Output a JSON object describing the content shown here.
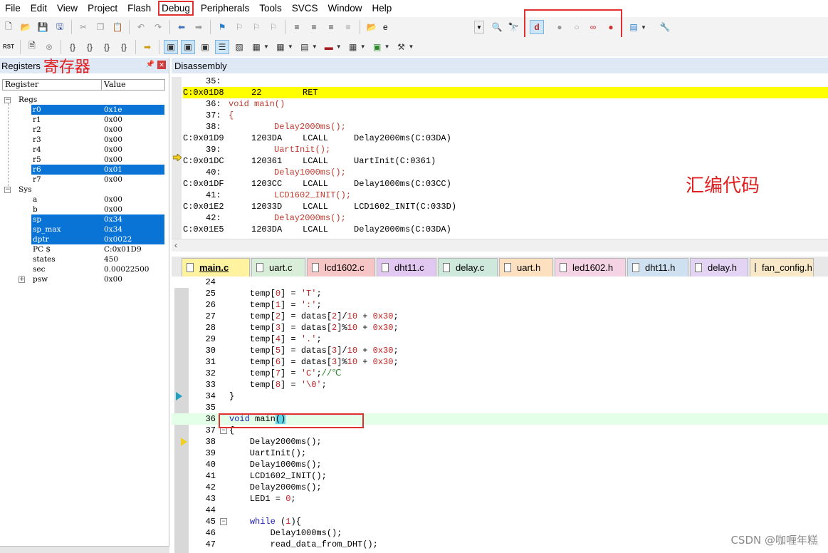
{
  "menu": [
    "File",
    "Edit",
    "View",
    "Project",
    "Flash",
    "Debug",
    "Peripherals",
    "Tools",
    "SVCS",
    "Window",
    "Help"
  ],
  "toolbar": {
    "combo_value": "e",
    "rst_label": "RST"
  },
  "registers": {
    "title": "Registers",
    "annotation": "寄存器",
    "col_register": "Register",
    "col_value": "Value",
    "regs_group": "Regs",
    "regs": [
      {
        "name": "r0",
        "value": "0x1e",
        "selected": true
      },
      {
        "name": "r1",
        "value": "0x00",
        "selected": false
      },
      {
        "name": "r2",
        "value": "0x00",
        "selected": false
      },
      {
        "name": "r3",
        "value": "0x00",
        "selected": false
      },
      {
        "name": "r4",
        "value": "0x00",
        "selected": false
      },
      {
        "name": "r5",
        "value": "0x00",
        "selected": false
      },
      {
        "name": "r6",
        "value": "0x01",
        "selected": true
      },
      {
        "name": "r7",
        "value": "0x00",
        "selected": false
      }
    ],
    "sys_group": "Sys",
    "sys": [
      {
        "name": "a",
        "value": "0x00",
        "selected": false
      },
      {
        "name": "b",
        "value": "0x00",
        "selected": false
      },
      {
        "name": "sp",
        "value": "0x34",
        "selected": true
      },
      {
        "name": "sp_max",
        "value": "0x34",
        "selected": true
      },
      {
        "name": "dptr",
        "value": "0x0022",
        "selected": true
      },
      {
        "name": "PC  $",
        "value": "C:0x01D9",
        "selected": false
      },
      {
        "name": "states",
        "value": "450",
        "selected": false
      },
      {
        "name": "sec",
        "value": "0.00022500",
        "selected": false
      }
    ],
    "psw": {
      "name": "psw",
      "value": "0x00"
    }
  },
  "disassembly": {
    "title": "Disassembly",
    "annotation": "汇编代码",
    "lines": [
      {
        "kind": "src",
        "num": "35:",
        "text": ""
      },
      {
        "kind": "asm",
        "addr": "C:0x01D8",
        "op": "22",
        "mn": "RET",
        "args": "",
        "current": true
      },
      {
        "kind": "src",
        "num": "36:",
        "text": "void main()"
      },
      {
        "kind": "src",
        "num": "37:",
        "text": "{"
      },
      {
        "kind": "src",
        "num": "38:",
        "text": "Delay2000ms();",
        "indent": true
      },
      {
        "kind": "asm",
        "addr": "C:0x01D9",
        "op": "1203DA",
        "mn": "LCALL",
        "args": "Delay2000ms(C:03DA)"
      },
      {
        "kind": "src",
        "num": "39:",
        "text": "UartInit();",
        "indent": true
      },
      {
        "kind": "asm",
        "addr": "C:0x01DC",
        "op": "120361",
        "mn": "LCALL",
        "args": "UartInit(C:0361)"
      },
      {
        "kind": "src",
        "num": "40:",
        "text": "Delay1000ms();",
        "indent": true
      },
      {
        "kind": "asm",
        "addr": "C:0x01DF",
        "op": "1203CC",
        "mn": "LCALL",
        "args": "Delay1000ms(C:03CC)"
      },
      {
        "kind": "src",
        "num": "41:",
        "text": "LCD1602_INIT();",
        "indent": true
      },
      {
        "kind": "asm",
        "addr": "C:0x01E2",
        "op": "12033D",
        "mn": "LCALL",
        "args": "LCD1602_INIT(C:033D)"
      },
      {
        "kind": "src",
        "num": "42:",
        "text": "Delay2000ms();",
        "indent": true
      },
      {
        "kind": "asm",
        "addr": "C:0x01E5",
        "op": "1203DA",
        "mn": "LCALL",
        "args": "Delay2000ms(C:03DA)"
      }
    ]
  },
  "tabs": [
    {
      "label": "main.c",
      "color": "#fff3a0",
      "active": true
    },
    {
      "label": "uart.c",
      "color": "#d8eed8"
    },
    {
      "label": "lcd1602.c",
      "color": "#f6c6c6"
    },
    {
      "label": "dht11.c",
      "color": "#e0c8f0"
    },
    {
      "label": "delay.c",
      "color": "#cfe8dc"
    },
    {
      "label": "uart.h",
      "color": "#fde0c0"
    },
    {
      "label": "led1602.h",
      "color": "#f4d4e4"
    },
    {
      "label": "dht11.h",
      "color": "#cfe0f0"
    },
    {
      "label": "delay.h",
      "color": "#e4d4f4"
    },
    {
      "label": "fan_config.h",
      "color": "#f8e8c8"
    }
  ],
  "code": {
    "lines": [
      {
        "n": "24",
        "text": ""
      },
      {
        "n": "25",
        "text": "    temp[0] = 'T';"
      },
      {
        "n": "26",
        "text": "    temp[1] = ':';"
      },
      {
        "n": "27",
        "text": "    temp[2] = datas[2]/10 + 0x30;"
      },
      {
        "n": "28",
        "text": "    temp[3] = datas[2]%10 + 0x30;"
      },
      {
        "n": "29",
        "text": "    temp[4] = '.';"
      },
      {
        "n": "30",
        "text": "    temp[5] = datas[3]/10 + 0x30;"
      },
      {
        "n": "31",
        "text": "    temp[6] = datas[3]%10 + 0x30;"
      },
      {
        "n": "32",
        "text": "    temp[7] = 'C';//℃"
      },
      {
        "n": "33",
        "text": "    temp[8] = '\\0';"
      },
      {
        "n": "34",
        "text": "}"
      },
      {
        "n": "35",
        "text": ""
      },
      {
        "n": "36",
        "text": "void main()"
      },
      {
        "n": "37",
        "text": "{"
      },
      {
        "n": "38",
        "text": "    Delay2000ms();"
      },
      {
        "n": "39",
        "text": "    UartInit();"
      },
      {
        "n": "40",
        "text": "    Delay1000ms();"
      },
      {
        "n": "41",
        "text": "    LCD1602_INIT();"
      },
      {
        "n": "42",
        "text": "    Delay2000ms();"
      },
      {
        "n": "43",
        "text": "    LED1 = 0;"
      },
      {
        "n": "44",
        "text": ""
      },
      {
        "n": "45",
        "text": "    while (1){"
      },
      {
        "n": "46",
        "text": "        Delay1000ms();"
      },
      {
        "n": "47",
        "text": "        read_data_from_DHT();"
      }
    ]
  },
  "watermark": "CSDN @咖喱年糕"
}
